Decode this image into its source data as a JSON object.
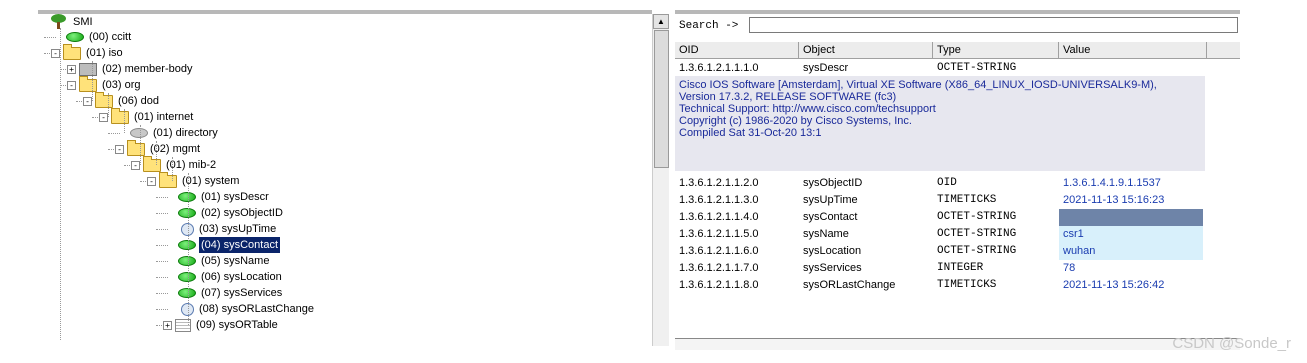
{
  "tree": {
    "nodes": [
      {
        "label": "SMI",
        "icon": "tree-icon",
        "expander": ""
      },
      {
        "label": "(00) ccitt",
        "icon": "leaf-icon",
        "expander": ""
      },
      {
        "label": "(01) iso",
        "icon": "folder-icon",
        "expander": "-"
      },
      {
        "label": "(02) member-body",
        "icon": "gray-folder-icon",
        "expander": "+"
      },
      {
        "label": "(03) org",
        "icon": "folder-icon",
        "expander": "-"
      },
      {
        "label": "(06) dod",
        "icon": "folder-icon",
        "expander": "-"
      },
      {
        "label": "(01) internet",
        "icon": "folder-icon",
        "expander": "-"
      },
      {
        "label": "(01) directory",
        "icon": "gray-leaf-icon",
        "expander": ""
      },
      {
        "label": "(02) mgmt",
        "icon": "folder-icon",
        "expander": "-"
      },
      {
        "label": "(01) mib-2",
        "icon": "folder-icon",
        "expander": "-"
      },
      {
        "label": "(01) system",
        "icon": "folder-icon",
        "expander": "-"
      },
      {
        "label": "(01) sysDescr",
        "icon": "leaf-icon",
        "expander": ""
      },
      {
        "label": "(02) sysObjectID",
        "icon": "leaf-icon",
        "expander": ""
      },
      {
        "label": "(03) sysUpTime",
        "icon": "clock-icon",
        "expander": ""
      },
      {
        "label": "(04) sysContact",
        "icon": "leaf-icon",
        "expander": "",
        "selected": true
      },
      {
        "label": "(05) sysName",
        "icon": "leaf-icon",
        "expander": ""
      },
      {
        "label": "(06) sysLocation",
        "icon": "leaf-icon",
        "expander": ""
      },
      {
        "label": "(07) sysServices",
        "icon": "leaf-icon",
        "expander": ""
      },
      {
        "label": "(08) sysORLastChange",
        "icon": "clock-icon",
        "expander": ""
      },
      {
        "label": "(09) sysORTable",
        "icon": "table-icon",
        "expander": "+"
      }
    ]
  },
  "search": {
    "label": "Search ->",
    "value": ""
  },
  "table": {
    "headers": [
      "OID",
      "Object",
      "Type",
      "Value"
    ],
    "descr_row": {
      "oid": "1.3.6.1.2.1.1.1.0",
      "object": "sysDescr",
      "type": "OCTET-STRING"
    },
    "descr_text": [
      "Cisco IOS Software [Amsterdam], Virtual XE Software (X86_64_LINUX_IOSD-UNIVERSALK9-M),",
      "Version 17.3.2, RELEASE SOFTWARE (fc3)",
      "Technical Support: http://www.cisco.com/techsupport",
      "Copyright (c) 1986-2020 by Cisco Systems, Inc.",
      "Compiled Sat 31-Oct-20 13:1"
    ],
    "rows": [
      {
        "oid": "1.3.6.1.2.1.1.2.0",
        "object": "sysObjectID",
        "type": "OID",
        "value": "1.3.6.1.4.1.9.1.1537",
        "style": "blue"
      },
      {
        "oid": "1.3.6.1.2.1.1.3.0",
        "object": "sysUpTime",
        "type": "TIMETICKS",
        "value": "2021-11-13 15:16:23",
        "style": "blue"
      },
      {
        "oid": "1.3.6.1.2.1.1.4.0",
        "object": "sysContact",
        "type": "OCTET-STRING",
        "value": "",
        "style": "dark"
      },
      {
        "oid": "1.3.6.1.2.1.1.5.0",
        "object": "sysName",
        "type": "OCTET-STRING",
        "value": "csr1",
        "style": "cyan"
      },
      {
        "oid": "1.3.6.1.2.1.1.6.0",
        "object": "sysLocation",
        "type": "OCTET-STRING",
        "value": "wuhan",
        "style": "cyan"
      },
      {
        "oid": "1.3.6.1.2.1.1.7.0",
        "object": "sysServices",
        "type": "INTEGER",
        "value": "78",
        "style": "blue"
      },
      {
        "oid": "1.3.6.1.2.1.1.8.0",
        "object": "sysORLastChange",
        "type": "TIMETICKS",
        "value": "2021-11-13 15:26:42",
        "style": "blue"
      }
    ]
  },
  "watermark": "CSDN @Sonde_r",
  "colors": {
    "selection": "#0a246a",
    "value_blue": "#1a3cb0",
    "value_cyan_bg": "#d8f0fb"
  }
}
